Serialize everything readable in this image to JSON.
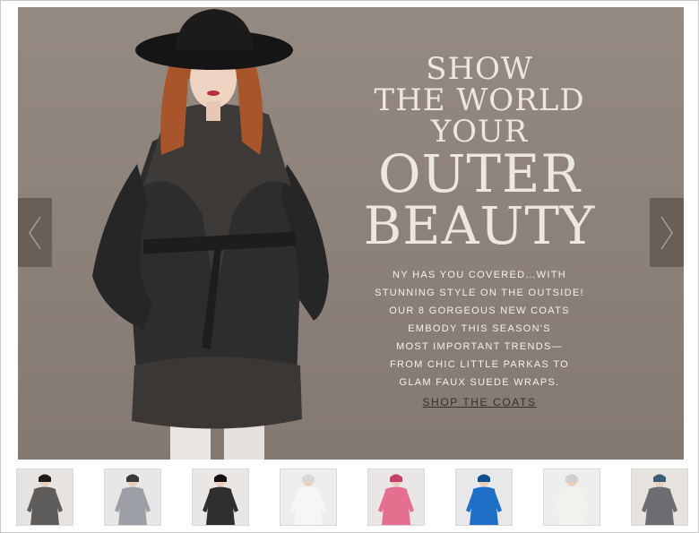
{
  "hero": {
    "headline_line1": "SHOW",
    "headline_line2": "THE WORLD",
    "headline_line3": "YOUR",
    "headline_line4": "OUTER",
    "headline_line5": "BEAUTY",
    "copy_lines": [
      "NY HAS YOU COVERED…WITH",
      "STUNNING STYLE ON THE OUTSIDE!",
      "OUR 8 GORGEOUS NEW COATS",
      "EMBODY THIS SEASON'S",
      "MOST IMPORTANT TRENDS—",
      "FROM CHIC LITTLE PARKAS TO",
      "GLAM FAUX SUEDE WRAPS."
    ],
    "cta_label": "SHOP THE COATS",
    "prev_icon": "chevron-left-icon",
    "next_icon": "chevron-right-icon"
  },
  "thumbnails": [
    {
      "coat": "gray wool coat with black fur collar",
      "bg": "#e7e3e0",
      "coat_color": "#5f5d5c",
      "accent": "#1d1d1d"
    },
    {
      "coat": "silver puffer jacket",
      "bg": "#e8e6e6",
      "coat_color": "#9c9fa6",
      "accent": "#3a3a3a"
    },
    {
      "coat": "black coat with hat",
      "bg": "#e9e6e3",
      "coat_color": "#2f2f2f",
      "accent": "#111111"
    },
    {
      "coat": "white puffer jacket",
      "bg": "#eeeeee",
      "coat_color": "#f6f6f4",
      "accent": "#d7d7d7"
    },
    {
      "coat": "pink puffer jacket with hat",
      "bg": "#eae6e6",
      "coat_color": "#e56f8f",
      "accent": "#c43f6a"
    },
    {
      "coat": "blue coat",
      "bg": "#e8e8ea",
      "coat_color": "#1f6fc6",
      "accent": "#11508f"
    },
    {
      "coat": "white belted coat",
      "bg": "#eeeeee",
      "coat_color": "#f2f1ee",
      "accent": "#cfcfcf"
    },
    {
      "coat": "patterned parka with knit hat",
      "bg": "#e6e3df",
      "coat_color": "#6c6d70",
      "accent": "#3a5c78"
    }
  ],
  "colors": {
    "hero_background": "#8f847c",
    "headline": "#ece7e1",
    "arrow_panel": "#6a5f56",
    "cta": "#3a2f28"
  }
}
